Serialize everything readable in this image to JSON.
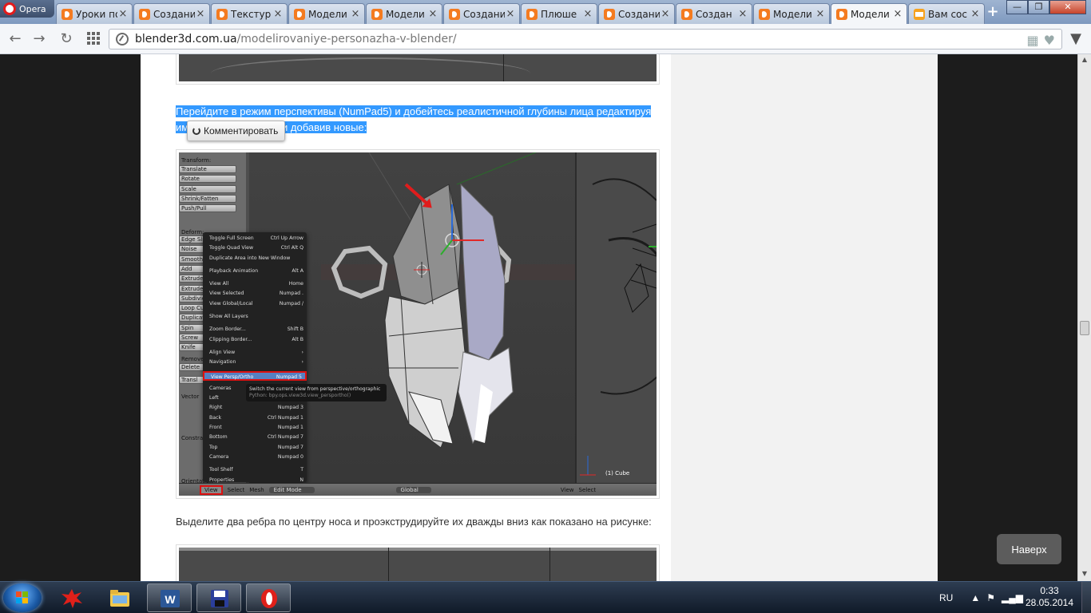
{
  "browser": {
    "opera_label": "Opera",
    "tabs": [
      {
        "label": "Уроки по",
        "active": false
      },
      {
        "label": "Создани",
        "active": false
      },
      {
        "label": "Текстур",
        "active": false
      },
      {
        "label": "Модели",
        "active": false
      },
      {
        "label": "Модели",
        "active": false
      },
      {
        "label": "Создани",
        "active": false
      },
      {
        "label": "Плюше",
        "active": false
      },
      {
        "label": "Создани",
        "active": false
      },
      {
        "label": "Создан",
        "active": false
      },
      {
        "label": "Модели",
        "active": false
      },
      {
        "label": "Модели",
        "active": true
      },
      {
        "label": "Вам сос",
        "active": false
      }
    ],
    "window_buttons": {
      "minimize": "—",
      "restore": "❐",
      "close": "✕"
    },
    "url_domain": "blender3d.com.ua",
    "url_path": "/modelirovaniye-personazha-v-blender/"
  },
  "article": {
    "para1_line1": "Перейдите в режим перспективы (NumPad5) и добейтесь реалистичной глубины лица редактируя",
    "para1_line2_a": "им",
    "para1_line2_b": "или добавив новые:",
    "comment_button": "Комментировать",
    "para2": "Выделите два ребра по центру носа и проэкструдируйте их дважды вниз как показано на рисунке:",
    "to_top": "Наверх"
  },
  "blender": {
    "side_labels": [
      "Transform:",
      "Deform:",
      "Remove:",
      "Vector",
      "Constraint",
      "Orientation"
    ],
    "side_buttons": [
      "Translate",
      "Rotate",
      "Scale",
      "Shrink/Fatten",
      "Push/Pull",
      "Edge Slide",
      "Noise",
      "Smooth V",
      "Add",
      "Extrude R",
      "Extrude In",
      "Subdivide",
      "Loop Cut",
      "Duplicate",
      "Spin",
      "Screw",
      "Knife",
      "Delete",
      "Transl"
    ],
    "menu": [
      {
        "label": "Toggle Full Screen",
        "key": "Ctrl Up Arrow"
      },
      {
        "label": "Toggle Quad View",
        "key": "Ctrl Alt Q"
      },
      {
        "label": "Duplicate Area into New Window",
        "key": ""
      },
      {
        "sep": true
      },
      {
        "label": "Playback Animation",
        "key": "Alt A"
      },
      {
        "sep": true
      },
      {
        "label": "View All",
        "key": "Home"
      },
      {
        "label": "View Selected",
        "key": "Numpad ."
      },
      {
        "label": "View Global/Local",
        "key": "Numpad /"
      },
      {
        "sep": true
      },
      {
        "label": "Show All Layers",
        "key": ""
      },
      {
        "sep": true
      },
      {
        "label": "Zoom Border...",
        "key": "Shift B"
      },
      {
        "label": "Clipping Border...",
        "key": "Alt B"
      },
      {
        "sep": true
      },
      {
        "label": "Align View",
        "key": "›"
      },
      {
        "label": "Navigation",
        "key": "›"
      },
      {
        "sep": true
      },
      {
        "label": "View Persp/Ortho",
        "key": "Numpad 5",
        "highlight": true
      },
      {
        "sep": true
      },
      {
        "label": "Cameras",
        "key": ""
      },
      {
        "label": "Left",
        "key": ""
      },
      {
        "label": "Right",
        "key": "Numpad 3"
      },
      {
        "label": "Back",
        "key": "Ctrl Numpad 1"
      },
      {
        "label": "Front",
        "key": "Numpad 1"
      },
      {
        "label": "Bottom",
        "key": "Ctrl Numpad 7"
      },
      {
        "label": "Top",
        "key": "Numpad 7"
      },
      {
        "label": "Camera",
        "key": "Numpad 0"
      },
      {
        "sep": true
      },
      {
        "label": "Tool Shelf",
        "key": "T"
      },
      {
        "label": "Properties",
        "key": "N"
      }
    ],
    "tooltip_line1": "Switch the current view from perspective/orthographic",
    "tooltip_line2": "Python: bpy.ops.view3d.view_persportho()",
    "bottom_view": "View",
    "bottom_select": "Select",
    "bottom_mesh": "Mesh",
    "bottom_mode": "Edit Mode",
    "bottom_global": "Global",
    "bottom_view2": "View",
    "bottom_select2": "Select",
    "cube_label": "(1) Cube"
  },
  "taskbar": {
    "language": "RU",
    "time": "0:33",
    "date": "28.05.2014"
  }
}
